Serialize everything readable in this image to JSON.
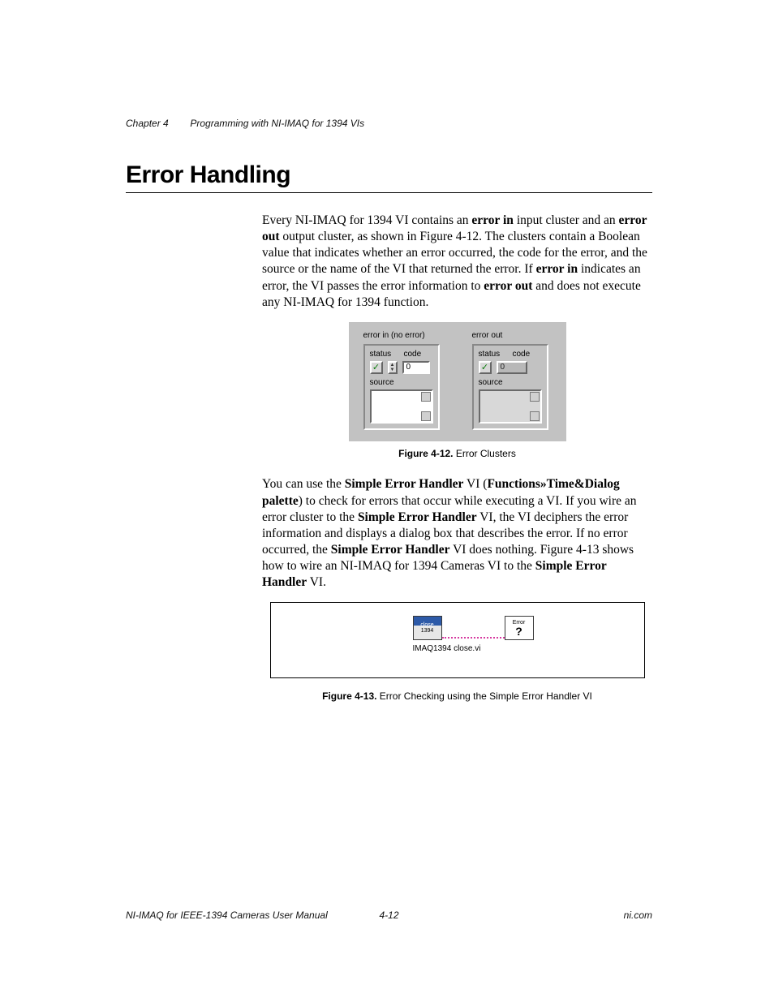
{
  "header": {
    "chapter_label": "Chapter 4",
    "chapter_title": "Programming with NI-IMAQ for 1394 VIs"
  },
  "section_title": "Error Handling",
  "para1": {
    "t1": "Every NI-IMAQ for 1394 VI contains an ",
    "b1": "error in",
    "t2": " input cluster and an ",
    "b2": "error out",
    "t3": " output cluster, as shown in Figure 4-12. The clusters contain a Boolean value that indicates whether an error occurred, the code for the error, and the source or the name of the VI that returned the error. If ",
    "b3": "error in",
    "t4": " indicates an error, the VI passes the error information to ",
    "b4": "error out",
    "t5": " and does not execute any NI-IMAQ for 1394 function."
  },
  "figure12": {
    "caption_label": "Figure 4-12.  ",
    "caption_text": "Error Clusters",
    "error_in": {
      "title": "error in (no error)",
      "status_label": "status",
      "code_label": "code",
      "code_value": "0",
      "source_label": "source"
    },
    "error_out": {
      "title": "error out",
      "status_label": "status",
      "code_label": "code",
      "code_value": "0",
      "source_label": "source"
    }
  },
  "para2": {
    "t1": "You can use the ",
    "b1": "Simple Error Handler",
    "t2": " VI (",
    "b2": "Functions»Time&Dialog palette",
    "t3": ") to check for errors that occur while executing a VI. If you wire an error cluster to the ",
    "b3": "Simple Error Handler",
    "t4": " VI, the VI deciphers the error information and displays a dialog box that describes the error. If no error occurred, the ",
    "b4": "Simple Error Handler",
    "t5": " VI does nothing. Figure 4-13 shows how to wire an NI-IMAQ for 1394 Cameras VI to the ",
    "b5": "Simple Error Handler",
    "t6": " VI."
  },
  "figure13": {
    "caption_label": "Figure 4-13.  ",
    "caption_text": "Error Checking using the Simple Error Handler VI",
    "close_icon_top": "close",
    "close_icon_sub": "1394",
    "err_icon_top": "Error",
    "err_icon_q": "?",
    "wire_caption": "IMAQ1394 close.vi"
  },
  "footer": {
    "left": "NI-IMAQ for IEEE-1394 Cameras User Manual",
    "center": "4-12",
    "right": "ni.com"
  }
}
